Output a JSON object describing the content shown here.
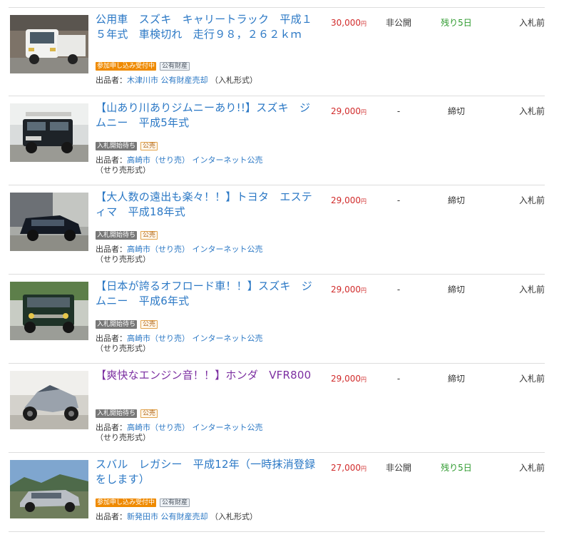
{
  "listings": [
    {
      "title": "公用車　スズキ　キャリートラック　平成１５年式　車検切れ　走行９８，２６２ｋｍ",
      "badges": [
        {
          "label": "参加申し込み受付中",
          "kind": "accepting"
        },
        {
          "label": "公有財産",
          "kind": "public-property"
        }
      ],
      "seller_prefix": "出品者：",
      "seller_name": "木津川市 公有財産売却",
      "seller_format": "（入札形式）",
      "price": "30,000",
      "yen": "円",
      "bids": "非公開",
      "remaining": "残り5日",
      "remaining_color": "#2e9a2e",
      "status": "入札前",
      "image": "white-kei-truck"
    },
    {
      "title": "【山あり川ありジムニーあり!!】スズキ　ジムニー　平成5年式",
      "badges": [
        {
          "label": "入札開始待ち",
          "kind": "waiting"
        },
        {
          "label": "公売",
          "kind": "kouhai"
        }
      ],
      "seller_prefix": "出品者：",
      "seller_name": "高崎市（せり売） インターネット公売",
      "seller_format": "（せり売形式）",
      "price": "29,000",
      "yen": "円",
      "bids": "-",
      "remaining": "締切",
      "remaining_color": "#333333",
      "status": "入札前",
      "image": "dark-jimny"
    },
    {
      "title": "【大人数の遠出も楽々！！】トヨタ　エスティマ　平成18年式",
      "badges": [
        {
          "label": "入札開始待ち",
          "kind": "waiting"
        },
        {
          "label": "公売",
          "kind": "kouhai"
        }
      ],
      "seller_prefix": "出品者：",
      "seller_name": "高崎市（せり売） インターネット公売",
      "seller_format": "（せり売形式）",
      "price": "29,000",
      "yen": "円",
      "bids": "-",
      "remaining": "締切",
      "remaining_color": "#333333",
      "status": "入札前",
      "image": "black-minivan"
    },
    {
      "title": "【日本が誇るオフロード車！！】スズキ　ジムニー　平成6年式",
      "badges": [
        {
          "label": "入札開始待ち",
          "kind": "waiting"
        },
        {
          "label": "公売",
          "kind": "kouhai"
        }
      ],
      "seller_prefix": "出品者：",
      "seller_name": "高崎市（せり売） インターネット公売",
      "seller_format": "（せり売形式）",
      "price": "29,000",
      "yen": "円",
      "bids": "-",
      "remaining": "締切",
      "remaining_color": "#333333",
      "status": "入札前",
      "image": "green-jimny"
    },
    {
      "title": "【爽快なエンジン音！！】ホンダ　VFR800",
      "title_visited": true,
      "badges": [
        {
          "label": "入札開始待ち",
          "kind": "waiting"
        },
        {
          "label": "公売",
          "kind": "kouhai"
        }
      ],
      "seller_prefix": "出品者：",
      "seller_name": "高崎市（せり売） インターネット公売",
      "seller_format": "（せり売形式）",
      "price": "29,000",
      "yen": "円",
      "bids": "-",
      "remaining": "締切",
      "remaining_color": "#333333",
      "status": "入札前",
      "image": "silver-motorcycle"
    },
    {
      "title": "スバル　レガシー　平成12年（一時抹消登録をします）",
      "badges": [
        {
          "label": "参加申し込み受付中",
          "kind": "accepting"
        },
        {
          "label": "公有財産",
          "kind": "public-property"
        }
      ],
      "seller_prefix": "出品者：",
      "seller_name": "新発田市 公有財産売却",
      "seller_format": "（入札形式）",
      "price": "27,000",
      "yen": "円",
      "bids": "非公開",
      "remaining": "残り5日",
      "remaining_color": "#2e9a2e",
      "status": "入札前",
      "image": "silver-sedan"
    }
  ]
}
